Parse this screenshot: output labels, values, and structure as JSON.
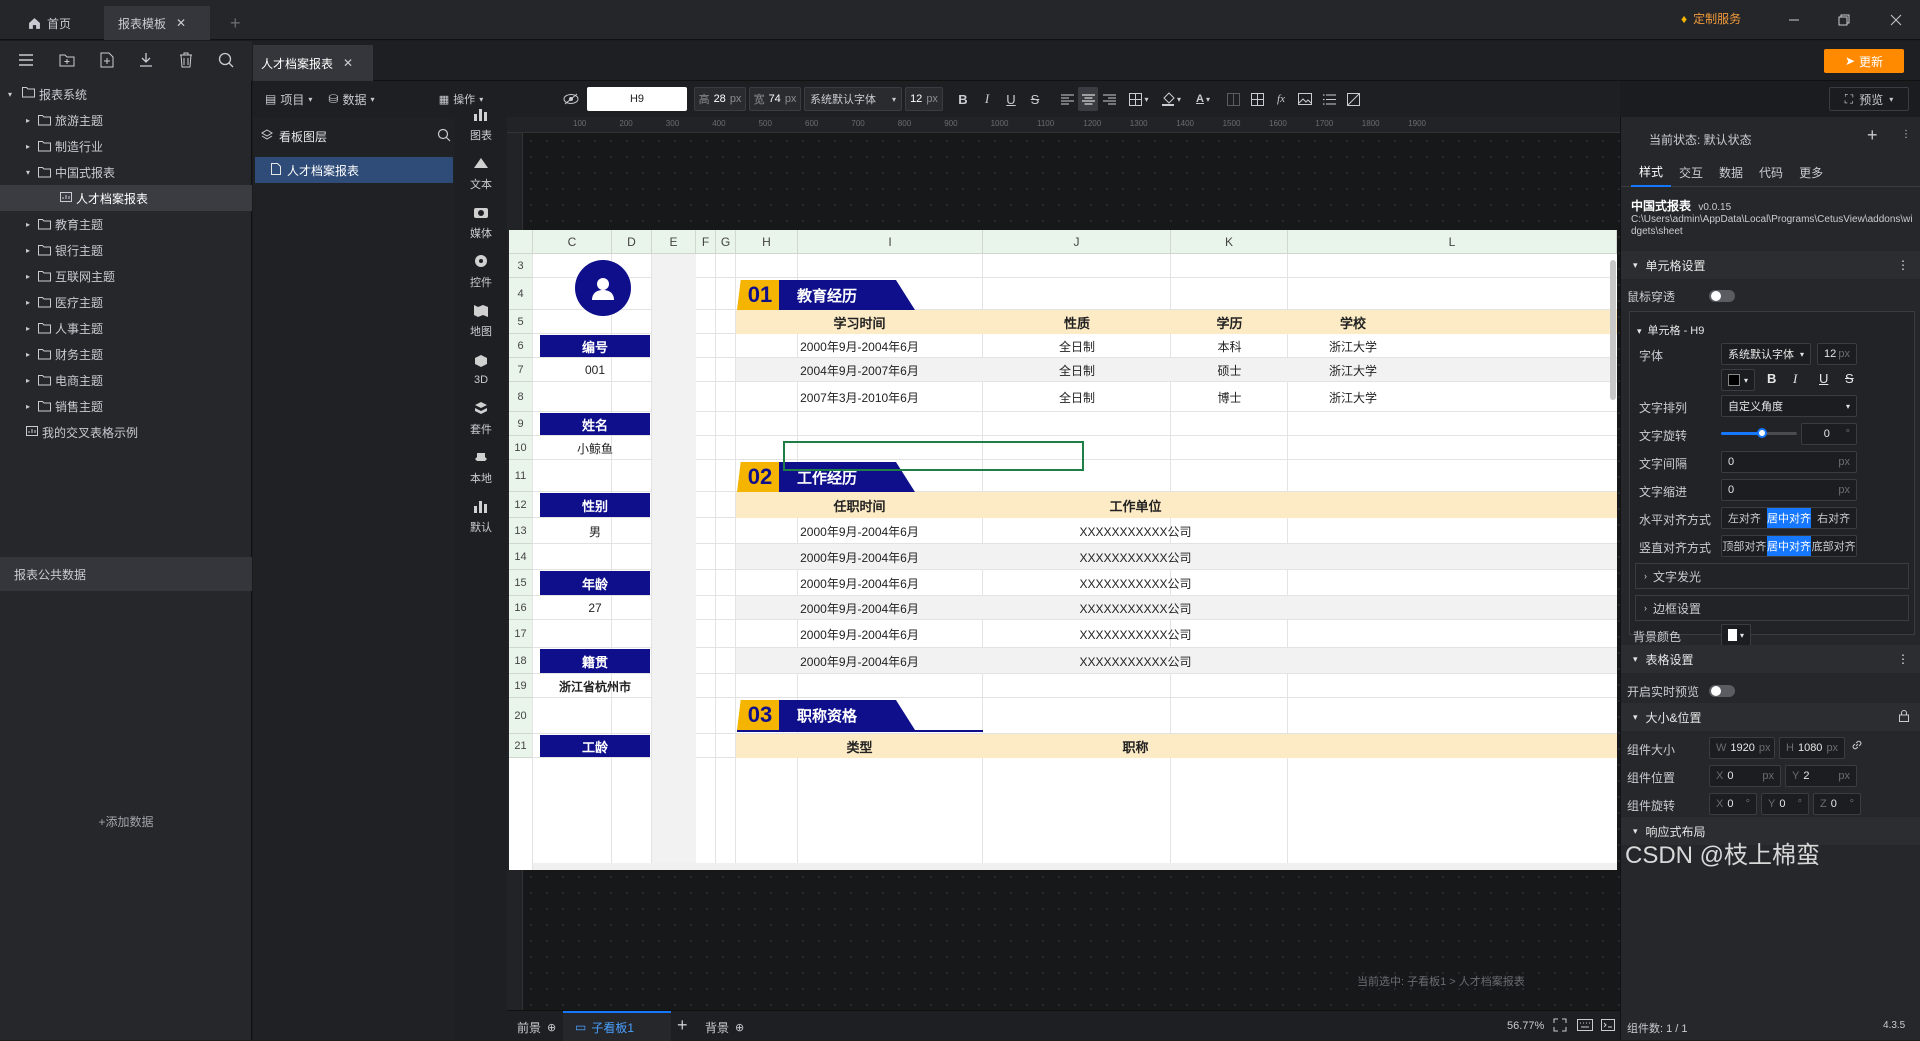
{
  "tabs": {
    "home": "首页",
    "template": "报表模板"
  },
  "topbar": {
    "service": "定制服务",
    "update": "更新"
  },
  "doc_tab": "人才档案报表",
  "tree": {
    "root": "报表系统",
    "items": [
      "旅游主题",
      "制造行业",
      "中国式报表",
      "人才档案报表",
      "教育主题",
      "银行主题",
      "互联网主题",
      "医疗主题",
      "人事主题",
      "财务主题",
      "电商主题",
      "销售主题",
      "我的交叉表格示例"
    ]
  },
  "left_bottom": {
    "title": "报表公共数据",
    "add": "+添加数据"
  },
  "layer": {
    "title": "看板图层",
    "item": "人才档案报表"
  },
  "menus": {
    "project": "项目",
    "data": "数据",
    "ops": "操作"
  },
  "categories": [
    "图表",
    "文本",
    "媒体",
    "控件",
    "地图",
    "3D",
    "套件",
    "本地",
    "默认"
  ],
  "toolbar": {
    "cell": "H9",
    "height_label": "高",
    "height": "28",
    "width_label": "宽",
    "width": "74",
    "unit": "px",
    "font": "系统默认字体",
    "size": "12",
    "preview": "预览"
  },
  "ruler_top": [
    "100",
    "200",
    "300",
    "400",
    "500",
    "600",
    "700",
    "800",
    "900",
    "1000",
    "1100",
    "1200",
    "1300",
    "1400",
    "1500",
    "1600",
    "1700",
    "1800",
    "1900"
  ],
  "sheet": {
    "col_headers": [
      "C",
      "D",
      "E",
      "F",
      "G",
      "H",
      "I",
      "J",
      "K",
      "L"
    ],
    "row_headers": [
      "3",
      "4",
      "5",
      "6",
      "7",
      "8",
      "9",
      "10",
      "11",
      "12",
      "13",
      "14",
      "15",
      "16",
      "17",
      "18",
      "19",
      "20",
      "21"
    ],
    "left_labels": [
      "编号",
      "姓名",
      "性别",
      "年龄",
      "籍贯",
      "工龄"
    ],
    "left_values": [
      "001",
      "小鲸鱼",
      "男",
      "27",
      "浙江省杭州市"
    ],
    "sections": [
      {
        "num": "01",
        "title": "教育经历"
      },
      {
        "num": "02",
        "title": "工作经历"
      },
      {
        "num": "03",
        "title": "职称资格"
      }
    ],
    "edu_headers": [
      "学习时间",
      "性质",
      "学历",
      "学校"
    ],
    "edu_rows": [
      [
        "2000年9月-2004年6月",
        "全日制",
        "本科",
        "浙江大学"
      ],
      [
        "2004年9月-2007年6月",
        "全日制",
        "硕士",
        "浙江大学"
      ],
      [
        "2007年3月-2010年6月",
        "全日制",
        "博士",
        "浙江大学"
      ]
    ],
    "work_headers": [
      "任职时间",
      "工作单位"
    ],
    "work_rows": [
      [
        "2000年9月-2004年6月",
        "XXXXXXXXXXX公司"
      ],
      [
        "2000年9月-2004年6月",
        "XXXXXXXXXXX公司"
      ],
      [
        "2000年9月-2004年6月",
        "XXXXXXXXXXX公司"
      ],
      [
        "2000年9月-2004年6月",
        "XXXXXXXXXXX公司"
      ],
      [
        "2000年9月-2004年6月",
        "XXXXXXXXXXX公司"
      ],
      [
        "2000年9月-2004年6月",
        "XXXXXXXXXXX公司"
      ]
    ],
    "title_headers": [
      "类型",
      "职称"
    ]
  },
  "canvas_status": "当前选中: 子看板1 > 人才档案报表",
  "bottom": {
    "front": "前景",
    "sub": "子看板1",
    "back": "背景",
    "zoom": "56.77%"
  },
  "right": {
    "state_label": "当前状态: 默认状态",
    "tabs": [
      "样式",
      "交互",
      "数据",
      "代码",
      "更多"
    ],
    "component_name": "中国式报表",
    "component_version": "v0.0.15",
    "path": "C:\\Users\\admin\\AppData\\Local\\Programs\\CetusView\\addons\\widgets\\sheet",
    "cell_settings": "单元格设置",
    "mouse_through": "鼠标穿透",
    "cell_title": "单元格 - H9",
    "font_label": "字体",
    "font_value": "系统默认字体",
    "font_size": "12",
    "arrange_label": "文字排列",
    "arrange_value": "自定义角度",
    "rotate_label": "文字旋转",
    "rotate_value": "0",
    "spacing_label": "文字间隔",
    "spacing_value": "0",
    "indent_label": "文字缩进",
    "indent_value": "0",
    "halign_label": "水平对齐方式",
    "halign": [
      "左对齐",
      "居中对齐",
      "右对齐"
    ],
    "valign_label": "竖直对齐方式",
    "valign": [
      "顶部对齐",
      "居中对齐",
      "底部对齐"
    ],
    "glow": "文字发光",
    "border": "边框设置",
    "bg_label": "背景颜色",
    "table_settings": "表格设置",
    "realtime": "开启实时预览",
    "size_pos": "大小&位置",
    "comp_size": "组件大小",
    "w": "1920",
    "h": "1080",
    "comp_pos": "组件位置",
    "x": "0",
    "y": "2",
    "comp_rot": "组件旋转",
    "rx": "0",
    "ry": "0",
    "rz": "0",
    "responsive": "响应式布局",
    "footer": "组件数: 1 / 1",
    "version": "4.3.5",
    "watermark": "CSDN @枝上棉蛮"
  },
  "colors": {
    "accent": "#0f0f8c",
    "gold": "#f5b400",
    "band": "#fdebc5",
    "orange": "#ff8a00",
    "blue": "#1677ff"
  }
}
